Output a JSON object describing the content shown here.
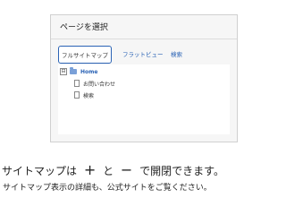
{
  "panel": {
    "title": "ページを選択",
    "tabs": [
      {
        "label": "フルサイトマップ"
      },
      {
        "label": "フラットビュー"
      },
      {
        "label": "検索"
      }
    ],
    "tree": [
      {
        "label": "Home",
        "toggle": "⊟"
      },
      {
        "label": "お問い合わせ"
      },
      {
        "label": "検索"
      }
    ]
  },
  "caption": {
    "line1_prefix": "サイトマップは",
    "plus_symbol": "+",
    "and_text": "と",
    "minus_symbol": "−",
    "line1_suffix": "で開閉できます。",
    "line2": "サイトマップ表示の詳細も、公式サイトをご覧ください。"
  }
}
